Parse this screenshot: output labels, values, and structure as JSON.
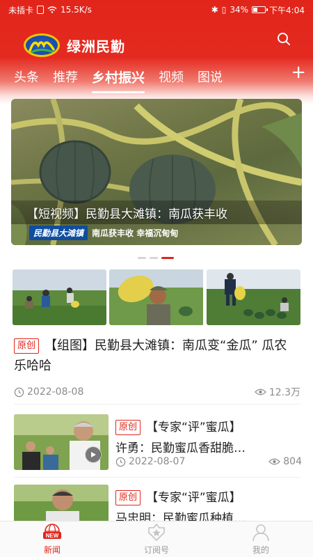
{
  "status_bar": {
    "carrier": "未插卡",
    "speed": "15.5K/s",
    "battery_percent": "34%",
    "battery_level": 0.34,
    "time": "下午4:04"
  },
  "header": {
    "app_name": "绿洲民勤",
    "tabs": [
      {
        "label": "头条",
        "active": false
      },
      {
        "label": "推荐",
        "active": false
      },
      {
        "label": "乡村振兴",
        "active": true
      },
      {
        "label": "视频",
        "active": false
      },
      {
        "label": "图说",
        "active": false
      }
    ],
    "add_tab_label": "+"
  },
  "carousel": {
    "caption": "【短视频】民勤县大滩镇：南瓜获丰收",
    "banner_chip": "民勤县大滩镇",
    "banner_text": "南瓜获丰收  幸福沉甸甸",
    "page_count": 3,
    "active_index": 2
  },
  "articles": [
    {
      "tag": "原创",
      "title": "【组图】民勤县大滩镇：南瓜变“金瓜” 瓜农乐哈哈",
      "date": "2022-08-08",
      "views": "12.3万"
    },
    {
      "tag": "原创",
      "title_line1": "【专家“评”蜜瓜】",
      "title_line2": "许勇：民勤蜜瓜香甜脆…",
      "date": "2022-08-07",
      "views": "804"
    },
    {
      "tag": "原创",
      "title_line1": "【专家“评”蜜瓜】",
      "title_line2": "马忠明：民勤蜜瓜种植…"
    }
  ],
  "bottom_nav": [
    {
      "label": "新闻",
      "badge": "NEW",
      "active": true
    },
    {
      "label": "订阅号",
      "active": false
    },
    {
      "label": "我的",
      "active": false
    }
  ],
  "colors": {
    "brand_red": "#e1251b",
    "meta_gray": "#8a8a8a"
  }
}
